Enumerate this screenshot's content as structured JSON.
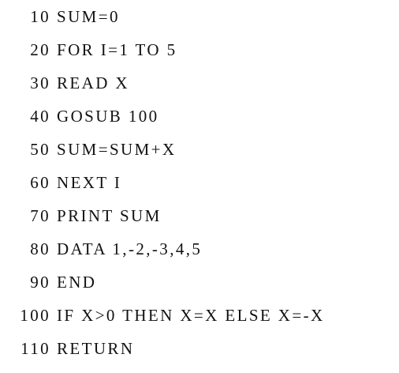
{
  "program": {
    "lines": [
      {
        "number": "10",
        "code": "SUM=0"
      },
      {
        "number": "20",
        "code": "FOR I=1 TO 5"
      },
      {
        "number": "30",
        "code": "READ X"
      },
      {
        "number": "40",
        "code": "GOSUB 100"
      },
      {
        "number": "50",
        "code": "SUM=SUM+X"
      },
      {
        "number": "60",
        "code": "NEXT I"
      },
      {
        "number": "70",
        "code": "PRINT SUM"
      },
      {
        "number": "80",
        "code": "DATA 1,-2,-3,4,5"
      },
      {
        "number": "90",
        "code": "END"
      },
      {
        "number": "100",
        "code": "IF X>0 THEN X=X ELSE X=-X"
      },
      {
        "number": "110",
        "code": "RETURN"
      }
    ]
  }
}
